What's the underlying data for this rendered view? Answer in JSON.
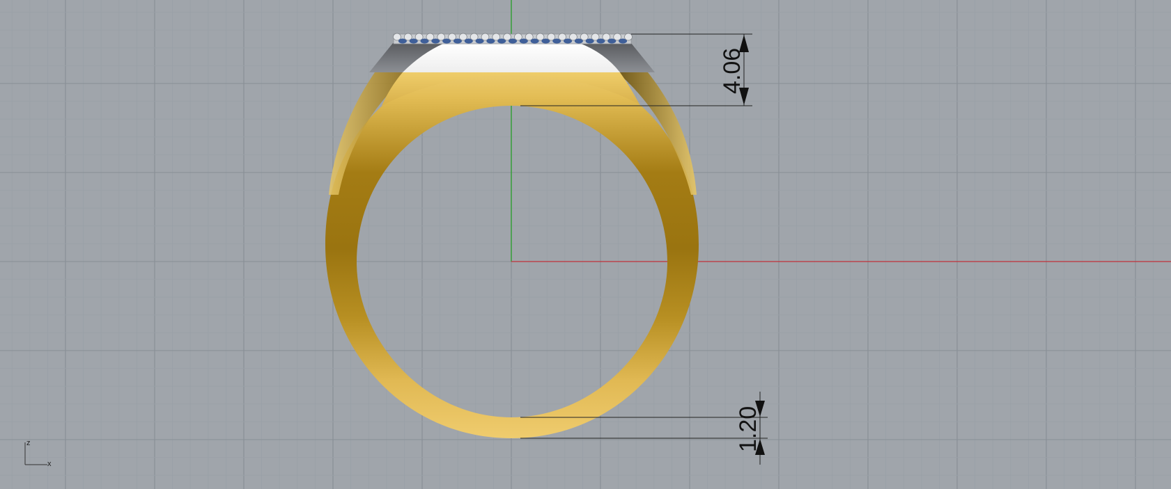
{
  "viewport": {
    "background": "#a0a5ab",
    "grid_minor_color": "#99a0a7",
    "grid_major_color": "#888e95",
    "x_axis_color": "#c0313a",
    "y_axis_color": "#1ea01e"
  },
  "model": {
    "metal_color_light": "#eac866",
    "metal_color_dark": "#9a7410",
    "stone_color": "#3f5f99"
  },
  "dimensions": {
    "top_height": "4.06",
    "shank_thickness": "1.20"
  },
  "axis_widget": {
    "z_label": "z",
    "x_label": "x"
  }
}
